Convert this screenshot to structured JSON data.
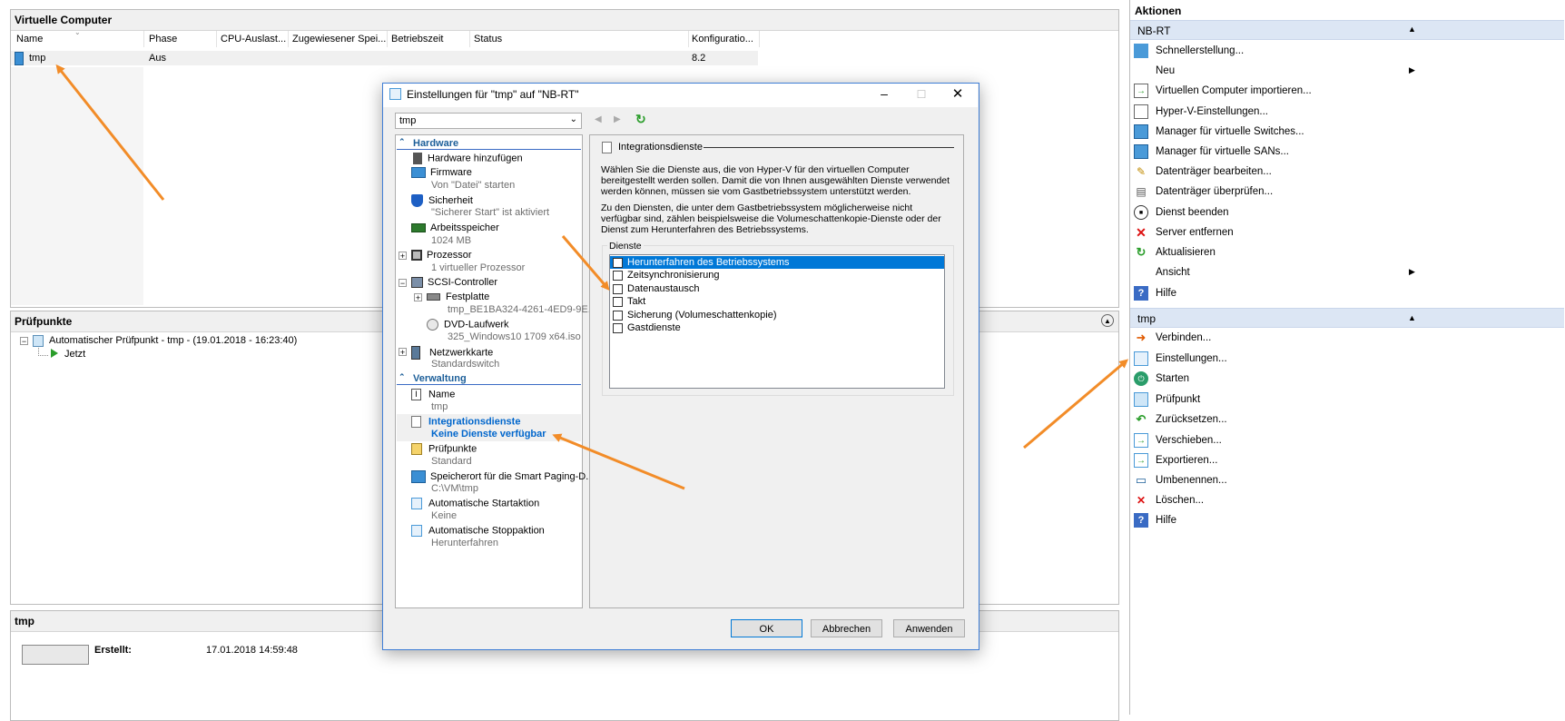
{
  "vm_panel": {
    "title": "Virtuelle Computer",
    "columns": [
      "Name",
      "Phase",
      "CPU-Auslast...",
      "Zugewiesener Spei...",
      "Betriebszeit",
      "Status",
      "Konfiguratio..."
    ],
    "rows": [
      {
        "name": "tmp",
        "phase": "Aus",
        "config": "8.2"
      }
    ]
  },
  "checkpoints_panel": {
    "title": "Prüfpunkte",
    "items": [
      {
        "label": "Automatischer Prüfpunkt - tmp - (19.01.2018 - 16:23:40)"
      },
      {
        "label": "Jetzt"
      }
    ]
  },
  "details_panel": {
    "title": "tmp",
    "created_label": "Erstellt:",
    "created_value": "17.01.2018 14:59:48"
  },
  "actions": {
    "title": "Aktionen",
    "server_section": "NB-RT",
    "server_items": [
      {
        "label": "Schnellerstellung...",
        "icon": "quick-create-icon"
      },
      {
        "label": "Neu",
        "icon": "new-icon",
        "submenu": true
      },
      {
        "label": "Virtuellen Computer importieren...",
        "icon": "import-icon"
      },
      {
        "label": "Hyper-V-Einstellungen...",
        "icon": "settings-doc-icon"
      },
      {
        "label": "Manager für virtuelle Switches...",
        "icon": "switch-icon"
      },
      {
        "label": "Manager für virtuelle SANs...",
        "icon": "san-icon"
      },
      {
        "label": "Datenträger bearbeiten...",
        "icon": "disk-edit-icon"
      },
      {
        "label": "Datenträger überprüfen...",
        "icon": "disk-inspect-icon"
      },
      {
        "label": "Dienst beenden",
        "icon": "stop-service-icon"
      },
      {
        "label": "Server entfernen",
        "icon": "remove-server-icon"
      },
      {
        "label": "Aktualisieren",
        "icon": "refresh-icon"
      },
      {
        "label": "Ansicht",
        "icon": "view-icon",
        "submenu": true
      },
      {
        "label": "Hilfe",
        "icon": "help-icon"
      }
    ],
    "vm_section": "tmp",
    "vm_items": [
      {
        "label": "Verbinden...",
        "icon": "connect-icon"
      },
      {
        "label": "Einstellungen...",
        "icon": "vm-settings-icon"
      },
      {
        "label": "Starten",
        "icon": "power-icon"
      },
      {
        "label": "Prüfpunkt",
        "icon": "checkpoint-icon"
      },
      {
        "label": "Zurücksetzen...",
        "icon": "revert-icon"
      },
      {
        "label": "Verschieben...",
        "icon": "move-icon"
      },
      {
        "label": "Exportieren...",
        "icon": "export-icon"
      },
      {
        "label": "Umbenennen...",
        "icon": "rename-icon"
      },
      {
        "label": "Löschen...",
        "icon": "delete-icon"
      },
      {
        "label": "Hilfe",
        "icon": "help-icon"
      }
    ]
  },
  "dialog": {
    "title": "Einstellungen für \"tmp\" auf \"NB-RT\"",
    "vm_select": "tmp",
    "hardware_header": "Hardware",
    "management_header": "Verwaltung",
    "tree": {
      "add_hw": "Hardware hinzufügen",
      "firmware": "Firmware",
      "firmware_sub": "Von \"Datei\" starten",
      "security": "Sicherheit",
      "security_sub": "\"Sicherer Start\" ist aktiviert",
      "memory": "Arbeitsspeicher",
      "memory_sub": "1024 MB",
      "cpu": "Prozessor",
      "cpu_sub": "1 virtueller Prozessor",
      "scsi": "SCSI-Controller",
      "hdd": "Festplatte",
      "hdd_sub": "tmp_BE1BA324-4261-4ED9-9E...",
      "dvd": "DVD-Laufwerk",
      "dvd_sub": "325_Windows10 1709 x64.iso",
      "nic": "Netzwerkkarte",
      "nic_sub": "Standardswitch",
      "name": "Name",
      "name_sub": "tmp",
      "integration": "Integrationsdienste",
      "integration_sub": "Keine Dienste verfügbar",
      "checkpoints": "Prüfpunkte",
      "checkpoints_sub": "Standard",
      "paging": "Speicherort für die Smart Paging-D...",
      "paging_sub": "C:\\VM\\tmp",
      "autostart": "Automatische Startaktion",
      "autostart_sub": "Keine",
      "autostop": "Automatische Stoppaktion",
      "autostop_sub": "Herunterfahren"
    },
    "section_title": "Integrationsdienste",
    "desc1": "Wählen Sie die Dienste aus, die von Hyper-V für den virtuellen Computer bereitgestellt werden sollen. Damit die von Ihnen ausgewählten Dienste verwendet werden können, müssen sie vom Gastbetriebssystem unterstützt werden.",
    "desc2": "Zu den Diensten, die unter dem Gastbetriebssystem möglicherweise nicht verfügbar sind, zählen beispielsweise die Volumeschattenkopie-Dienste oder der Dienst zum Herunterfahren des Betriebssystems.",
    "services_label": "Dienste",
    "services": [
      "Herunterfahren des Betriebssystems",
      "Zeitsynchronisierung",
      "Datenaustausch",
      "Takt",
      "Sicherung (Volumeschattenkopie)",
      "Gastdienste"
    ],
    "ok": "OK",
    "cancel": "Abbrechen",
    "apply": "Anwenden"
  },
  "colors": {
    "accent": "#0066cc",
    "arrow": "#f28c28",
    "selection": "#0078d7"
  }
}
